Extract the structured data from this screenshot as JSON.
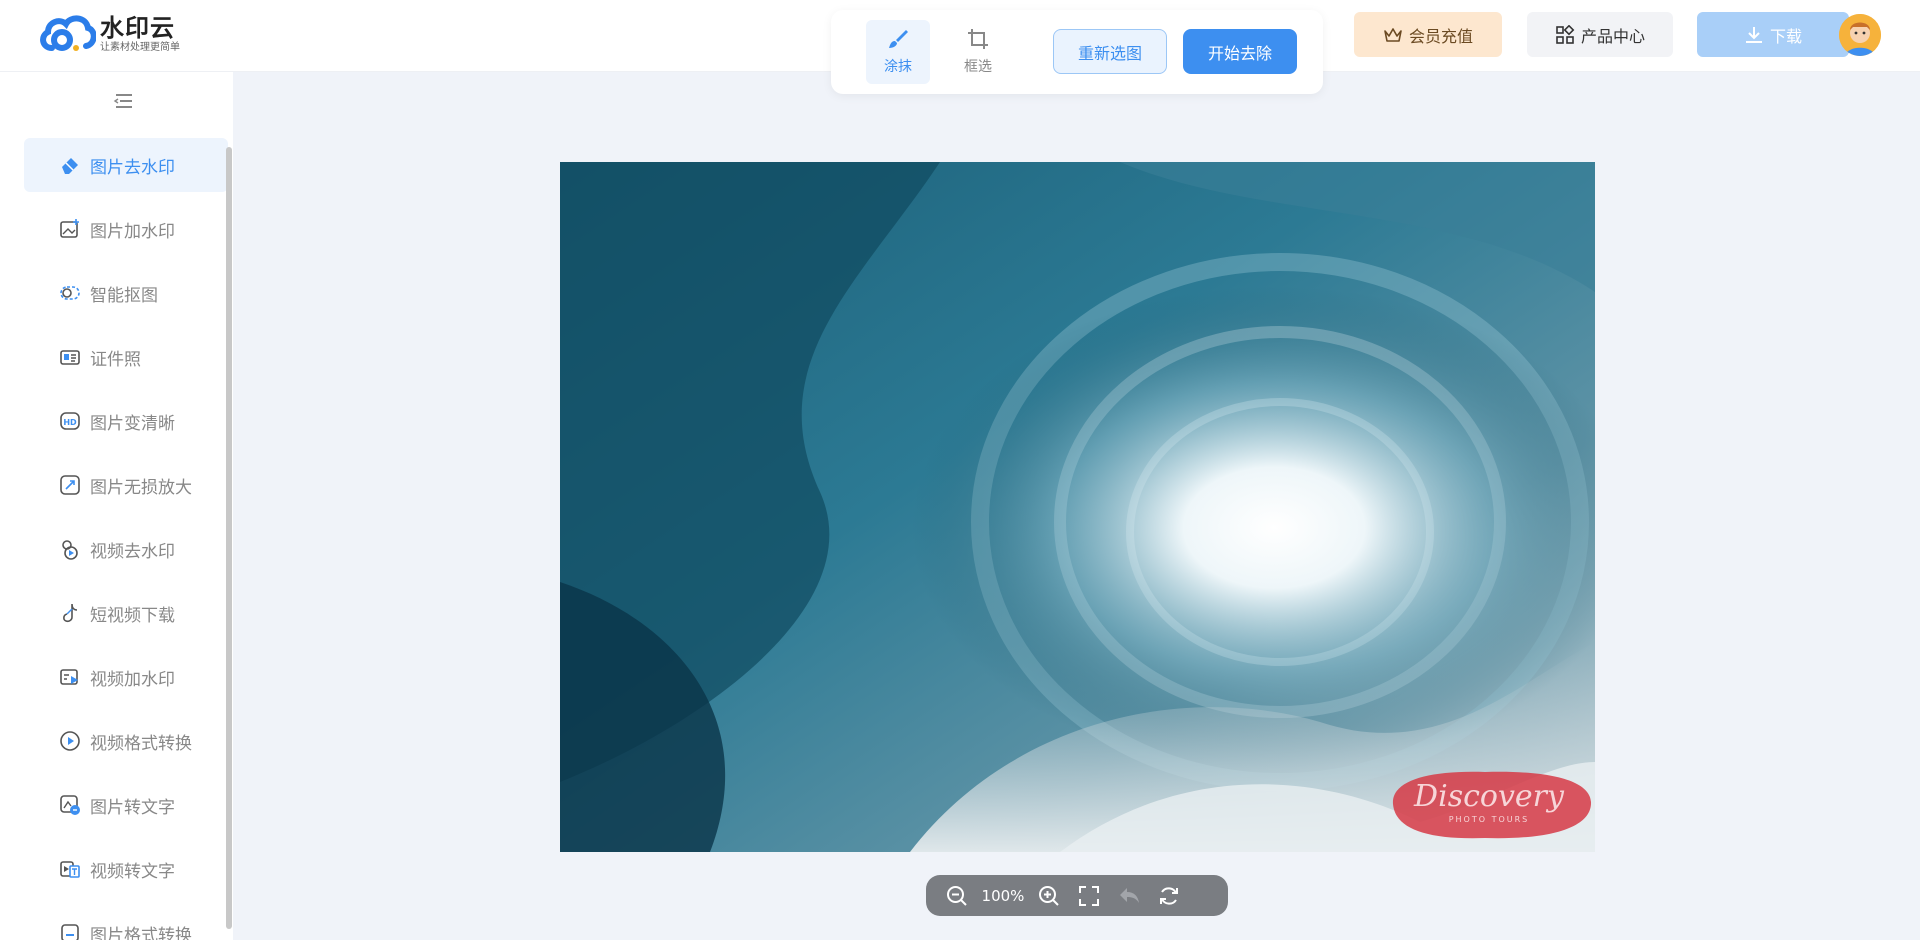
{
  "brand": {
    "title": "水印云",
    "subtitle": "让素材处理更简单"
  },
  "tools": {
    "paint": "涂抹",
    "crop": "框选",
    "reselect": "重新选图",
    "start": "开始去除"
  },
  "header": {
    "vip": "会员充值",
    "products": "产品中心",
    "download": "下载"
  },
  "sidebar": {
    "items": [
      {
        "label": "图片去水印",
        "icon": "eraser-icon",
        "active": true
      },
      {
        "label": "图片加水印",
        "icon": "image-add-icon"
      },
      {
        "label": "智能抠图",
        "icon": "cutout-icon"
      },
      {
        "label": "证件照",
        "icon": "id-card-icon"
      },
      {
        "label": "图片变清晰",
        "icon": "hd-icon"
      },
      {
        "label": "图片无损放大",
        "icon": "enlarge-icon"
      },
      {
        "label": "视频去水印",
        "icon": "video-erase-icon"
      },
      {
        "label": "短视频下载",
        "icon": "tiktok-icon"
      },
      {
        "label": "视频加水印",
        "icon": "video-add-icon"
      },
      {
        "label": "视频格式转换",
        "icon": "play-circle-icon"
      },
      {
        "label": "图片转文字",
        "icon": "image-text-icon"
      },
      {
        "label": "视频转文字",
        "icon": "video-text-icon"
      },
      {
        "label": "图片格式转换",
        "icon": "format-icon"
      }
    ]
  },
  "canvas": {
    "watermark_text": "Discovery",
    "watermark_sub": "PHOTO TOURS"
  },
  "zoom": {
    "level": "100%"
  },
  "colors": {
    "accent": "#3d8ff0",
    "vip_bg": "#fde7cf",
    "watermark": "#d63a45"
  }
}
